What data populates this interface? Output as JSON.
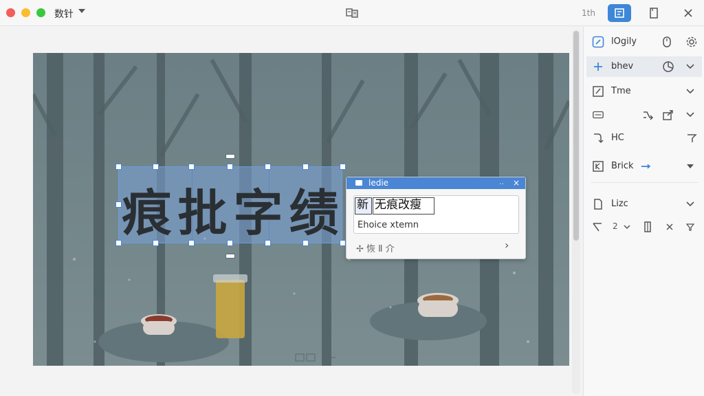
{
  "titlebar": {
    "app_title": "数针",
    "right_text": "1th"
  },
  "selection": {
    "chars": [
      "痕",
      "批",
      "字",
      "绩"
    ]
  },
  "popup": {
    "title": "ledie",
    "dots": "..",
    "close": "×",
    "token_a": "新",
    "token_b": "无痕改瘦",
    "sub_text": "Ehoice xtemn",
    "footer": "✢ 恢 Ⅱ 介",
    "chevron": "›"
  },
  "panel": {
    "rows": [
      {
        "label": "lOgily"
      },
      {
        "label": "bhev"
      },
      {
        "label": "Tme"
      },
      {
        "label": ""
      },
      {
        "label": "HC"
      },
      {
        "label": "Brick"
      },
      {
        "label": "Lizc"
      },
      {
        "label": ""
      }
    ],
    "number_value": "2"
  },
  "colors": {
    "accent": "#3d87d8",
    "selection": "#78a0d7",
    "popup_header": "#4a86d4"
  }
}
